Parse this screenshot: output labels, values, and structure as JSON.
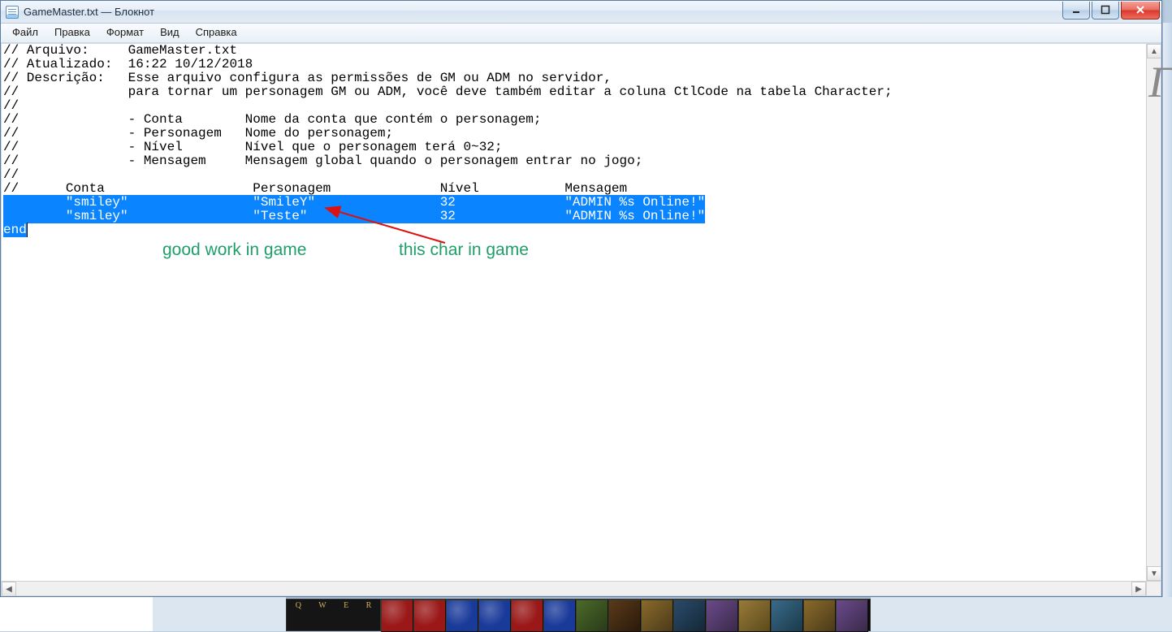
{
  "window": {
    "title": "GameMaster.txt — Блокнот"
  },
  "menus": {
    "file": "Файл",
    "edit": "Правка",
    "format": "Формат",
    "view": "Вид",
    "help": "Справка"
  },
  "file_content": {
    "header_lines": [
      "// Arquivo:     GameMaster.txt",
      "// Atualizado:  16:22 10/12/2018",
      "// Descrição:   Esse arquivo configura as permissões de GM ou ADM no servidor,",
      "//              para tornar um personagem GM ou ADM, você deve também editar a coluna CtlCode na tabela Character;",
      "//",
      "//              - Conta        Nome da conta que contém o personagem;",
      "//              - Personagem   Nome do personagem;",
      "//              - Nível        Nível que o personagem terá 0~32;",
      "//              - Mensagem     Mensagem global quando o personagem entrar no jogo;",
      "//"
    ],
    "columns_line": "//      Conta                   Personagem              Nível           Mensagem",
    "selected_rows": [
      "        \"smiley\"                \"SmileY\"                32              \"ADMIN %s Online!\"",
      "        \"smiley\"                \"Teste\"                 32              \"ADMIN %s Online!\""
    ],
    "end_keyword": "end"
  },
  "annotations": {
    "left": "good work in game",
    "right": "this char in game"
  },
  "gamebar": {
    "keys": [
      "Q",
      "W",
      "E",
      "R"
    ]
  }
}
